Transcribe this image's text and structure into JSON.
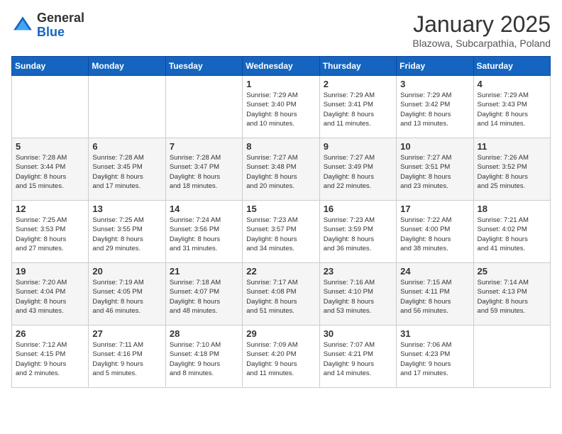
{
  "header": {
    "logo_general": "General",
    "logo_blue": "Blue",
    "title": "January 2025",
    "subtitle": "Blazowa, Subcarpathia, Poland"
  },
  "days_of_week": [
    "Sunday",
    "Monday",
    "Tuesday",
    "Wednesday",
    "Thursday",
    "Friday",
    "Saturday"
  ],
  "weeks": [
    [
      {
        "day": "",
        "detail": ""
      },
      {
        "day": "",
        "detail": ""
      },
      {
        "day": "",
        "detail": ""
      },
      {
        "day": "1",
        "detail": "Sunrise: 7:29 AM\nSunset: 3:40 PM\nDaylight: 8 hours\nand 10 minutes."
      },
      {
        "day": "2",
        "detail": "Sunrise: 7:29 AM\nSunset: 3:41 PM\nDaylight: 8 hours\nand 11 minutes."
      },
      {
        "day": "3",
        "detail": "Sunrise: 7:29 AM\nSunset: 3:42 PM\nDaylight: 8 hours\nand 13 minutes."
      },
      {
        "day": "4",
        "detail": "Sunrise: 7:29 AM\nSunset: 3:43 PM\nDaylight: 8 hours\nand 14 minutes."
      }
    ],
    [
      {
        "day": "5",
        "detail": "Sunrise: 7:28 AM\nSunset: 3:44 PM\nDaylight: 8 hours\nand 15 minutes."
      },
      {
        "day": "6",
        "detail": "Sunrise: 7:28 AM\nSunset: 3:45 PM\nDaylight: 8 hours\nand 17 minutes."
      },
      {
        "day": "7",
        "detail": "Sunrise: 7:28 AM\nSunset: 3:47 PM\nDaylight: 8 hours\nand 18 minutes."
      },
      {
        "day": "8",
        "detail": "Sunrise: 7:27 AM\nSunset: 3:48 PM\nDaylight: 8 hours\nand 20 minutes."
      },
      {
        "day": "9",
        "detail": "Sunrise: 7:27 AM\nSunset: 3:49 PM\nDaylight: 8 hours\nand 22 minutes."
      },
      {
        "day": "10",
        "detail": "Sunrise: 7:27 AM\nSunset: 3:51 PM\nDaylight: 8 hours\nand 23 minutes."
      },
      {
        "day": "11",
        "detail": "Sunrise: 7:26 AM\nSunset: 3:52 PM\nDaylight: 8 hours\nand 25 minutes."
      }
    ],
    [
      {
        "day": "12",
        "detail": "Sunrise: 7:25 AM\nSunset: 3:53 PM\nDaylight: 8 hours\nand 27 minutes."
      },
      {
        "day": "13",
        "detail": "Sunrise: 7:25 AM\nSunset: 3:55 PM\nDaylight: 8 hours\nand 29 minutes."
      },
      {
        "day": "14",
        "detail": "Sunrise: 7:24 AM\nSunset: 3:56 PM\nDaylight: 8 hours\nand 31 minutes."
      },
      {
        "day": "15",
        "detail": "Sunrise: 7:23 AM\nSunset: 3:57 PM\nDaylight: 8 hours\nand 34 minutes."
      },
      {
        "day": "16",
        "detail": "Sunrise: 7:23 AM\nSunset: 3:59 PM\nDaylight: 8 hours\nand 36 minutes."
      },
      {
        "day": "17",
        "detail": "Sunrise: 7:22 AM\nSunset: 4:00 PM\nDaylight: 8 hours\nand 38 minutes."
      },
      {
        "day": "18",
        "detail": "Sunrise: 7:21 AM\nSunset: 4:02 PM\nDaylight: 8 hours\nand 41 minutes."
      }
    ],
    [
      {
        "day": "19",
        "detail": "Sunrise: 7:20 AM\nSunset: 4:04 PM\nDaylight: 8 hours\nand 43 minutes."
      },
      {
        "day": "20",
        "detail": "Sunrise: 7:19 AM\nSunset: 4:05 PM\nDaylight: 8 hours\nand 46 minutes."
      },
      {
        "day": "21",
        "detail": "Sunrise: 7:18 AM\nSunset: 4:07 PM\nDaylight: 8 hours\nand 48 minutes."
      },
      {
        "day": "22",
        "detail": "Sunrise: 7:17 AM\nSunset: 4:08 PM\nDaylight: 8 hours\nand 51 minutes."
      },
      {
        "day": "23",
        "detail": "Sunrise: 7:16 AM\nSunset: 4:10 PM\nDaylight: 8 hours\nand 53 minutes."
      },
      {
        "day": "24",
        "detail": "Sunrise: 7:15 AM\nSunset: 4:11 PM\nDaylight: 8 hours\nand 56 minutes."
      },
      {
        "day": "25",
        "detail": "Sunrise: 7:14 AM\nSunset: 4:13 PM\nDaylight: 8 hours\nand 59 minutes."
      }
    ],
    [
      {
        "day": "26",
        "detail": "Sunrise: 7:12 AM\nSunset: 4:15 PM\nDaylight: 9 hours\nand 2 minutes."
      },
      {
        "day": "27",
        "detail": "Sunrise: 7:11 AM\nSunset: 4:16 PM\nDaylight: 9 hours\nand 5 minutes."
      },
      {
        "day": "28",
        "detail": "Sunrise: 7:10 AM\nSunset: 4:18 PM\nDaylight: 9 hours\nand 8 minutes."
      },
      {
        "day": "29",
        "detail": "Sunrise: 7:09 AM\nSunset: 4:20 PM\nDaylight: 9 hours\nand 11 minutes."
      },
      {
        "day": "30",
        "detail": "Sunrise: 7:07 AM\nSunset: 4:21 PM\nDaylight: 9 hours\nand 14 minutes."
      },
      {
        "day": "31",
        "detail": "Sunrise: 7:06 AM\nSunset: 4:23 PM\nDaylight: 9 hours\nand 17 minutes."
      },
      {
        "day": "",
        "detail": ""
      }
    ]
  ]
}
